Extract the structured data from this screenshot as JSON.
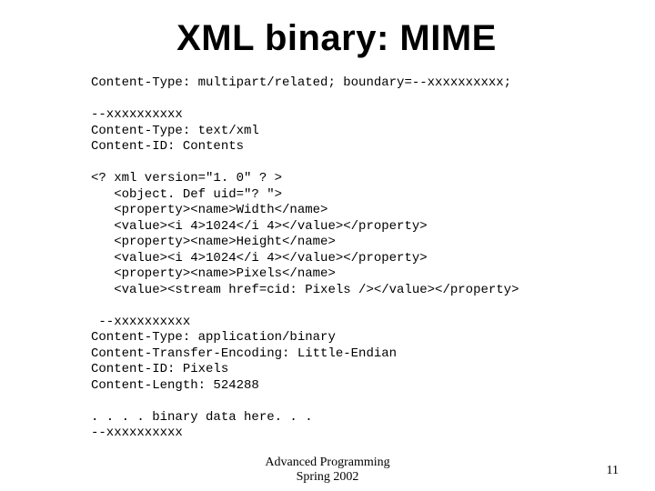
{
  "title": "XML binary: MIME",
  "code": "Content-Type: multipart/related; boundary=--xxxxxxxxxx;\n\n--xxxxxxxxxx\nContent-Type: text/xml\nContent-ID: Contents\n\n<? xml version=\"1. 0\" ? >\n   <object. Def uid=\"? \">\n   <property><name>Width</name>\n   <value><i 4>1024</i 4></value></property>\n   <property><name>Height</name>\n   <value><i 4>1024</i 4></value></property>\n   <property><name>Pixels</name>\n   <value><stream href=cid: Pixels /></value></property>\n\n --xxxxxxxxxx\nContent-Type: application/binary\nContent-Transfer-Encoding: Little-Endian\nContent-ID: Pixels\nContent-Length: 524288\n\n. . . . binary data here. . .\n--xxxxxxxxxx",
  "footer": {
    "course": "Advanced Programming",
    "term": "Spring 2002"
  },
  "page_number": "11"
}
